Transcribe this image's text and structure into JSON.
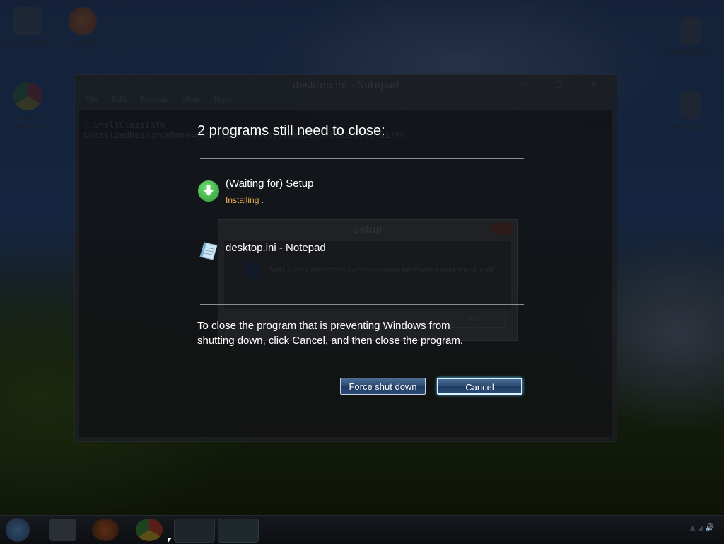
{
  "desktop": {
    "icons": [
      {
        "label": "Recycle Bin",
        "icon": "recycle-bin-icon"
      },
      {
        "label": "Firefox",
        "icon": "firefox-icon"
      },
      {
        "label": "Google Chrome",
        "icon": "chrome-icon"
      },
      {
        "label": "desktop.ini",
        "icon": "file-icon"
      },
      {
        "label": "desktop.ini",
        "icon": "file-icon"
      }
    ]
  },
  "bg_window": {
    "title": "desktop.ini - Notepad",
    "menu": [
      "File",
      "Edit",
      "Format",
      "View",
      "Help"
    ],
    "code_lines": [
      "[.ShellClassInfo]",
      "LocalizedResourceName=@%SystemRoot%\\system32\\shell32.dll,-21799"
    ]
  },
  "setup_dialog": {
    "title": "Setup",
    "message": "Setup has detected configuration problems and must exit.",
    "ok_label": "OK"
  },
  "shutdown": {
    "heading": "2 programs still need to close:",
    "programs": [
      {
        "name": "(Waiting for) Setup",
        "status": "Installing .",
        "icon": "download-arrow-icon"
      },
      {
        "name": "desktop.ini - Notepad",
        "status": "",
        "icon": "notepad-icon"
      }
    ],
    "explain_line1": "To close the program that is preventing Windows from",
    "explain_line2": "shutting down, click Cancel, and then close the program.",
    "force_label": "Force shut down",
    "cancel_label": "Cancel"
  },
  "colors": {
    "status_orange": "#f2b451",
    "button_blue": "#2b4a72",
    "focus_glow": "#56c8ff"
  }
}
